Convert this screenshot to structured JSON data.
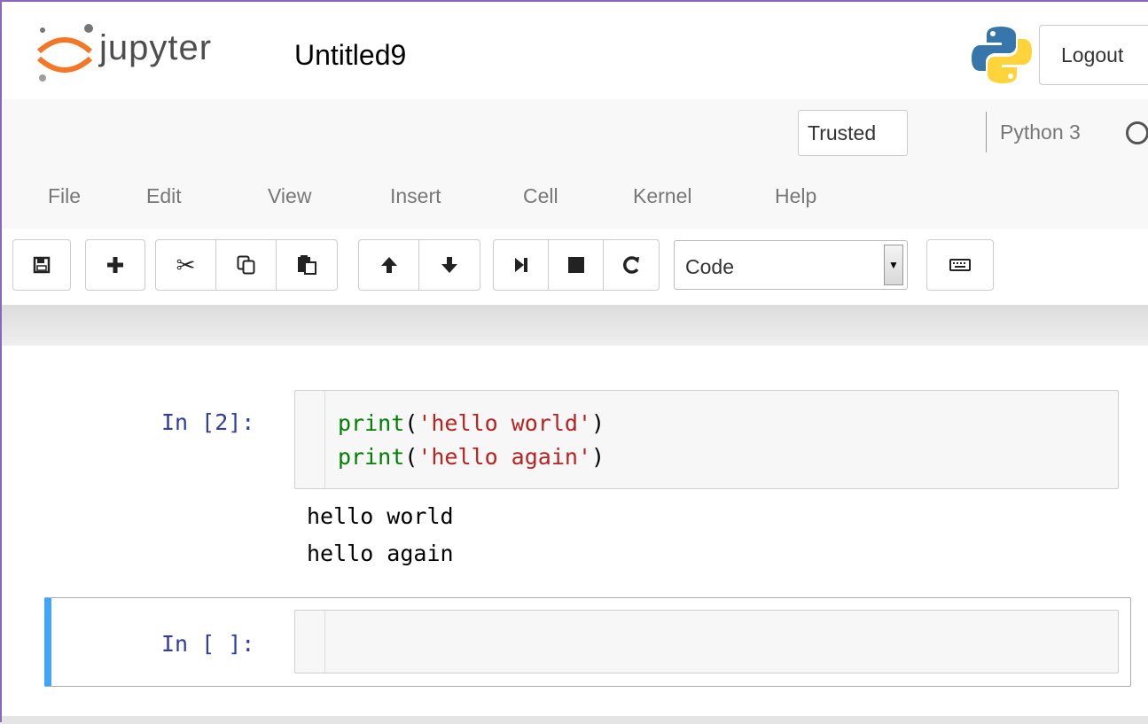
{
  "header": {
    "brand": "jupyter",
    "notebook_title": "Untitled9",
    "logout_label": "Logout"
  },
  "status": {
    "trusted_label": "Trusted",
    "kernel_name": "Python 3"
  },
  "menu": [
    "File",
    "Edit",
    "View",
    "Insert",
    "Cell",
    "Kernel",
    "Help"
  ],
  "toolbar": {
    "icons": [
      "save-icon",
      "plus-icon",
      "scissors-icon",
      "copy-icon",
      "paste-icon",
      "arrow-up-icon",
      "arrow-down-icon",
      "run-icon",
      "stop-icon",
      "restart-icon",
      "keyboard-icon"
    ],
    "cell_type": "Code"
  },
  "cells": [
    {
      "prompt": "In [2]:",
      "code_lines": [
        {
          "fn": "print",
          "open": "(",
          "str": "'hello world'",
          "close": ")"
        },
        {
          "fn": "print",
          "open": "(",
          "str": "'hello again'",
          "close": ")"
        }
      ],
      "output_lines": [
        "hello world",
        "hello again"
      ]
    },
    {
      "prompt": "In [ ]:",
      "code_lines": [],
      "output_lines": []
    }
  ],
  "colors": {
    "selection_bar": "#42a5f5",
    "prompt": "#303f9f",
    "keyword": "#008000",
    "string": "#ba2121"
  }
}
